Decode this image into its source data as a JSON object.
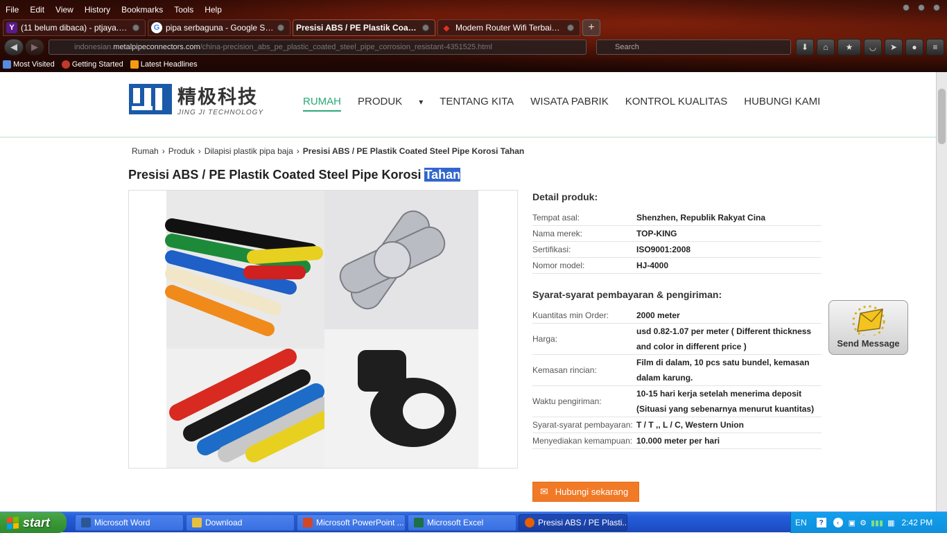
{
  "browser": {
    "menu": [
      "File",
      "Edit",
      "View",
      "History",
      "Bookmarks",
      "Tools",
      "Help"
    ],
    "tabs": [
      {
        "label": "(11 belum dibaca) - ptjaya.pra...",
        "favicon": "yahoo-favicon",
        "color": "#5a1a8a",
        "glyph": "Y"
      },
      {
        "label": "pipa serbaguna - Google Search",
        "favicon": "google-favicon",
        "color": "#ffffff",
        "glyph": "G"
      },
      {
        "label": "Presisi ABS / PE Plastik Coate...",
        "favicon": "site-favicon",
        "color": "#3a1a14",
        "glyph": ""
      },
      {
        "label": "Modem Router Wifi Terbaik di ...",
        "favicon": "router-favicon",
        "color": "#cc3322",
        "glyph": "◆"
      }
    ],
    "url_prefix": "indonesian.",
    "url_domain": "metalpipeconnectors.com",
    "url_path": "/china-precision_abs_pe_plastic_coated_steel_pipe_corrosion_resistant-4351525.html",
    "search_placeholder": "Search",
    "bookmarks": [
      "Most Visited",
      "Getting Started",
      "Latest Headlines"
    ]
  },
  "site": {
    "logo_cn": "精极科技",
    "logo_en": "JING JI TECHNOLOGY",
    "nav": [
      "RUMAH",
      "PRODUK",
      "TENTANG KITA",
      "WISATA PABRIK",
      "KONTROL KUALITAS",
      "HUBUNGI KAMI"
    ],
    "dropdown_glyph": "▾"
  },
  "breadcrumb": [
    "Rumah",
    "Produk",
    "Dilapisi plastik pipa baja",
    "Presisi ABS / PE Plastik Coated Steel Pipe Korosi Tahan"
  ],
  "product": {
    "title_main": "Presisi ABS / PE Plastik Coated Steel Pipe Korosi ",
    "title_selected": "Tahan",
    "details_title": "Detail produk:",
    "details": [
      {
        "k": "Tempat asal:",
        "v": "Shenzhen, Republik Rakyat Cina"
      },
      {
        "k": "Nama merek:",
        "v": "TOP-KING"
      },
      {
        "k": "Sertifikasi:",
        "v": "ISO9001:2008"
      },
      {
        "k": "Nomor model:",
        "v": "HJ-4000"
      }
    ],
    "terms_title": "Syarat-syarat pembayaran & pengiriman:",
    "terms": [
      {
        "k": "Kuantitas min Order:",
        "v": "2000 meter"
      },
      {
        "k": "Harga:",
        "v": "usd 0.82-1.07 per meter ( Different thickness and color in different price )"
      },
      {
        "k": "Kemasan rincian:",
        "v": "Film di dalam, 10 pcs satu bundel, kemasan dalam karung."
      },
      {
        "k": "Waktu pengiriman:",
        "v": "10-15 hari kerja setelah menerima deposit (Situasi yang sebenarnya menurut kuantitas)"
      },
      {
        "k": "Syarat-syarat pembayaran:",
        "v": "T / T ,, L / C, Western Union"
      },
      {
        "k": "Menyediakan kemampuan:",
        "v": "10.000 meter per hari"
      }
    ],
    "contact_label": "Hubungi sekarang",
    "send_message": "Send Message"
  },
  "taskbar": {
    "start": "start",
    "tasks": [
      {
        "label": "Microsoft Word",
        "color": "#2b5797"
      },
      {
        "label": "Download",
        "color": "#e8c040"
      },
      {
        "label": "Microsoft PowerPoint ...",
        "color": "#d24726"
      },
      {
        "label": "Microsoft Excel",
        "color": "#1e7145"
      },
      {
        "label": "Presisi ABS / PE Plasti...",
        "color": "#e66000"
      }
    ],
    "lang": "EN",
    "time": "2:42 PM"
  }
}
